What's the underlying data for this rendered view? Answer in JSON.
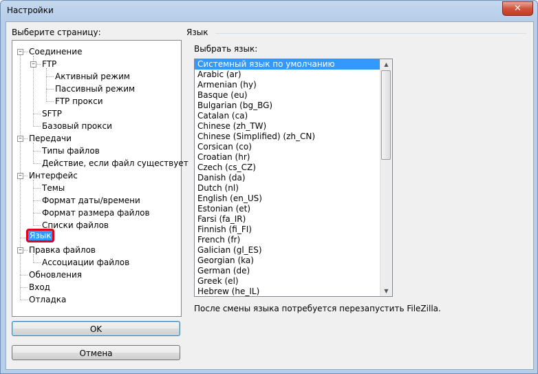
{
  "window": {
    "title": "Настройки",
    "close_glyph": "✕"
  },
  "left": {
    "label": "Выберите страницу:",
    "tree": [
      {
        "label": "Соединение",
        "level": 0,
        "expanded": true
      },
      {
        "label": "FTP",
        "level": 1,
        "expanded": true
      },
      {
        "label": "Активный режим",
        "level": 2
      },
      {
        "label": "Пассивный режим",
        "level": 2
      },
      {
        "label": "FTP прокси",
        "level": 2
      },
      {
        "label": "SFTP",
        "level": 1
      },
      {
        "label": "Базовый прокси",
        "level": 1
      },
      {
        "label": "Передачи",
        "level": 0,
        "expanded": true
      },
      {
        "label": "Типы файлов",
        "level": 1
      },
      {
        "label": "Действие, если файл существует",
        "level": 1
      },
      {
        "label": "Интерфейс",
        "level": 0,
        "expanded": true
      },
      {
        "label": "Темы",
        "level": 1
      },
      {
        "label": "Формат даты/времени",
        "level": 1
      },
      {
        "label": "Формат размера файлов",
        "level": 1
      },
      {
        "label": "Списки файлов",
        "level": 1
      },
      {
        "label": "Язык",
        "level": 0,
        "selected": true
      },
      {
        "label": "Правка файлов",
        "level": 0,
        "expanded": true
      },
      {
        "label": "Ассоциации файлов",
        "level": 1
      },
      {
        "label": "Обновления",
        "level": 0
      },
      {
        "label": "Вход",
        "level": 0
      },
      {
        "label": "Отладка",
        "level": 0
      }
    ],
    "ok_label": "OK",
    "cancel_label": "Отмена"
  },
  "language": {
    "group_title": "Язык",
    "select_label": "Выбрать язык:",
    "items": [
      "Системный язык по умолчанию",
      "Arabic (ar)",
      "Armenian (hy)",
      "Basque (eu)",
      "Bulgarian (bg_BG)",
      "Catalan (ca)",
      "Chinese (zh_TW)",
      "Chinese (Simplified) (zh_CN)",
      "Corsican (co)",
      "Croatian (hr)",
      "Czech (cs_CZ)",
      "Danish (da)",
      "Dutch (nl)",
      "English (en_US)",
      "Estonian (et)",
      "Farsi (fa_IR)",
      "Finnish (fi_FI)",
      "French (fr)",
      "Galician (gl_ES)",
      "Georgian (ka)",
      "German (de)",
      "Greek (el)",
      "Hebrew (he_IL)"
    ],
    "selected_index": 0,
    "restart_note": "После смены языка потребуется перезапустить FileZilla."
  },
  "colors": {
    "selection": "#3399ff",
    "highlight_border": "#e0001a",
    "close_button": "#c23b24"
  }
}
